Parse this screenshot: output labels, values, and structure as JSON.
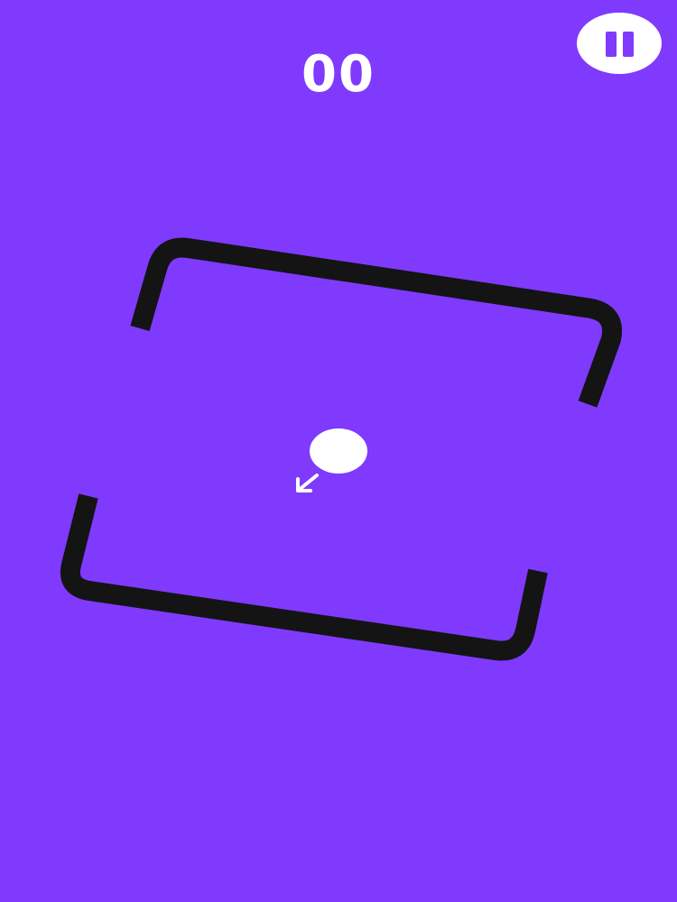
{
  "game": {
    "score": "00"
  },
  "controls": {
    "pause_icon": "pause-icon"
  },
  "colors": {
    "background": "#7F3AFD",
    "walls": "#141414",
    "ball": "#FFFFFF",
    "text": "#FFFFFF"
  }
}
